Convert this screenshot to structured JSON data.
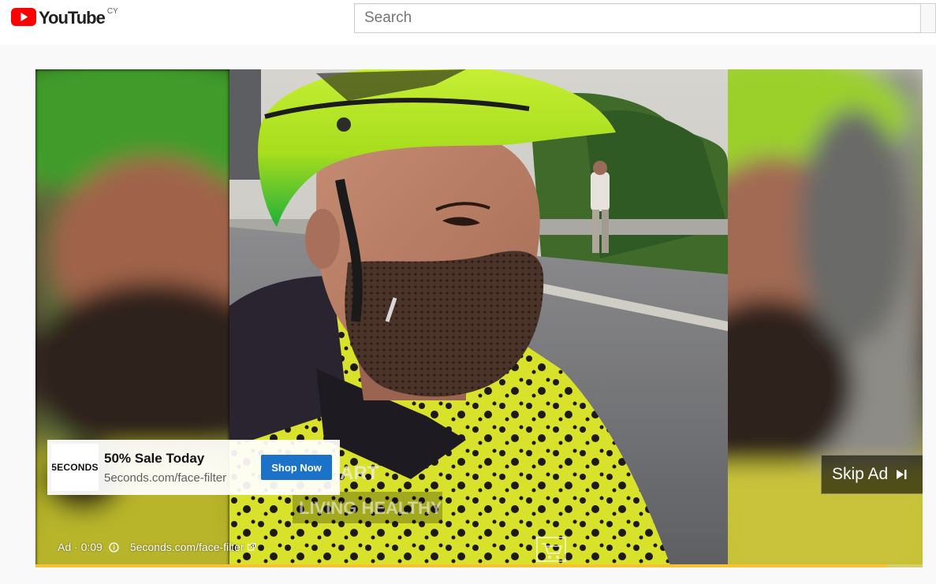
{
  "masthead": {
    "logo_text": "YouTube",
    "country_code": "CY",
    "search_placeholder": "Search"
  },
  "ad": {
    "advertiser_logo_text": "5ECONDS",
    "headline": "50% Sale Today",
    "display_url": "5econds.com/face-filter",
    "cta_label": "Shop Now",
    "skip_label": "Skip Ad",
    "ad_label": "Ad · 0:09",
    "visit_link": "5econds.com/face-filter",
    "progress_fraction": 0.96
  },
  "video": {
    "overlay_text_1": "ART",
    "overlay_text_2": "LIVING HEALTHY"
  },
  "icons": {
    "logo": "youtube-play-icon",
    "skip": "skip-next-icon",
    "info": "info-icon",
    "external": "external-link-icon",
    "cart": "cart-icon"
  },
  "colors": {
    "brand_red": "#ff0000",
    "cta_blue": "#1a73c8",
    "progress_yellow": "#fbc02d",
    "helmet_green": "#b5e61d"
  }
}
